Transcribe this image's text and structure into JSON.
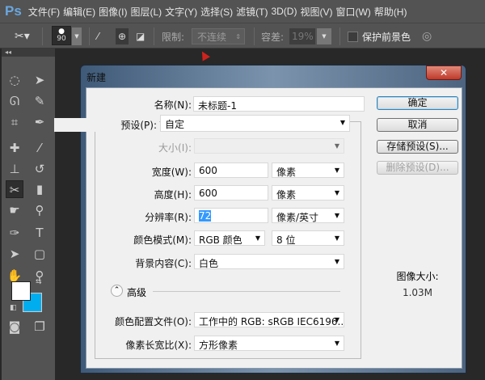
{
  "app": {
    "logo": "Ps",
    "menu": [
      "文件(F)",
      "编辑(E)",
      "图像(I)",
      "图层(L)",
      "文字(Y)",
      "选择(S)",
      "滤镜(T)",
      "3D(D)",
      "视图(V)",
      "窗口(W)",
      "帮助(H)"
    ]
  },
  "options": {
    "brush_size": "90",
    "limit_label": "限制:",
    "limit_value": "不连续",
    "tolerance_label": "容差:",
    "tolerance_value": "19%",
    "protect_label": "保护前景色"
  },
  "colors": {
    "foreground": "#ffffff",
    "background": "#00aeef"
  },
  "dialog": {
    "title": "新建",
    "close": "✕",
    "name_label": "名称(N):",
    "name_value": "未标题-1",
    "preset_label": "预设(P):",
    "preset_value": "自定",
    "size_label": "大小(I):",
    "width_label": "宽度(W):",
    "width_value": "600",
    "width_unit": "像素",
    "height_label": "高度(H):",
    "height_value": "600",
    "height_unit": "像素",
    "res_label": "分辨率(R):",
    "res_value": "72",
    "res_unit": "像素/英寸",
    "mode_label": "颜色模式(M):",
    "mode_value": "RGB 颜色",
    "depth_value": "8 位",
    "bg_label": "背景内容(C):",
    "bg_value": "白色",
    "advanced_label": "高级",
    "profile_label": "颜色配置文件(O):",
    "profile_value": "工作中的 RGB: sRGB IEC6196...",
    "aspect_label": "像素长宽比(X):",
    "aspect_value": "方形像素",
    "ok": "确定",
    "cancel": "取消",
    "save_preset": "存储预设(S)...",
    "delete_preset": "删除预设(D)...",
    "image_size_label": "图像大小:",
    "image_size_value": "1.03M"
  }
}
